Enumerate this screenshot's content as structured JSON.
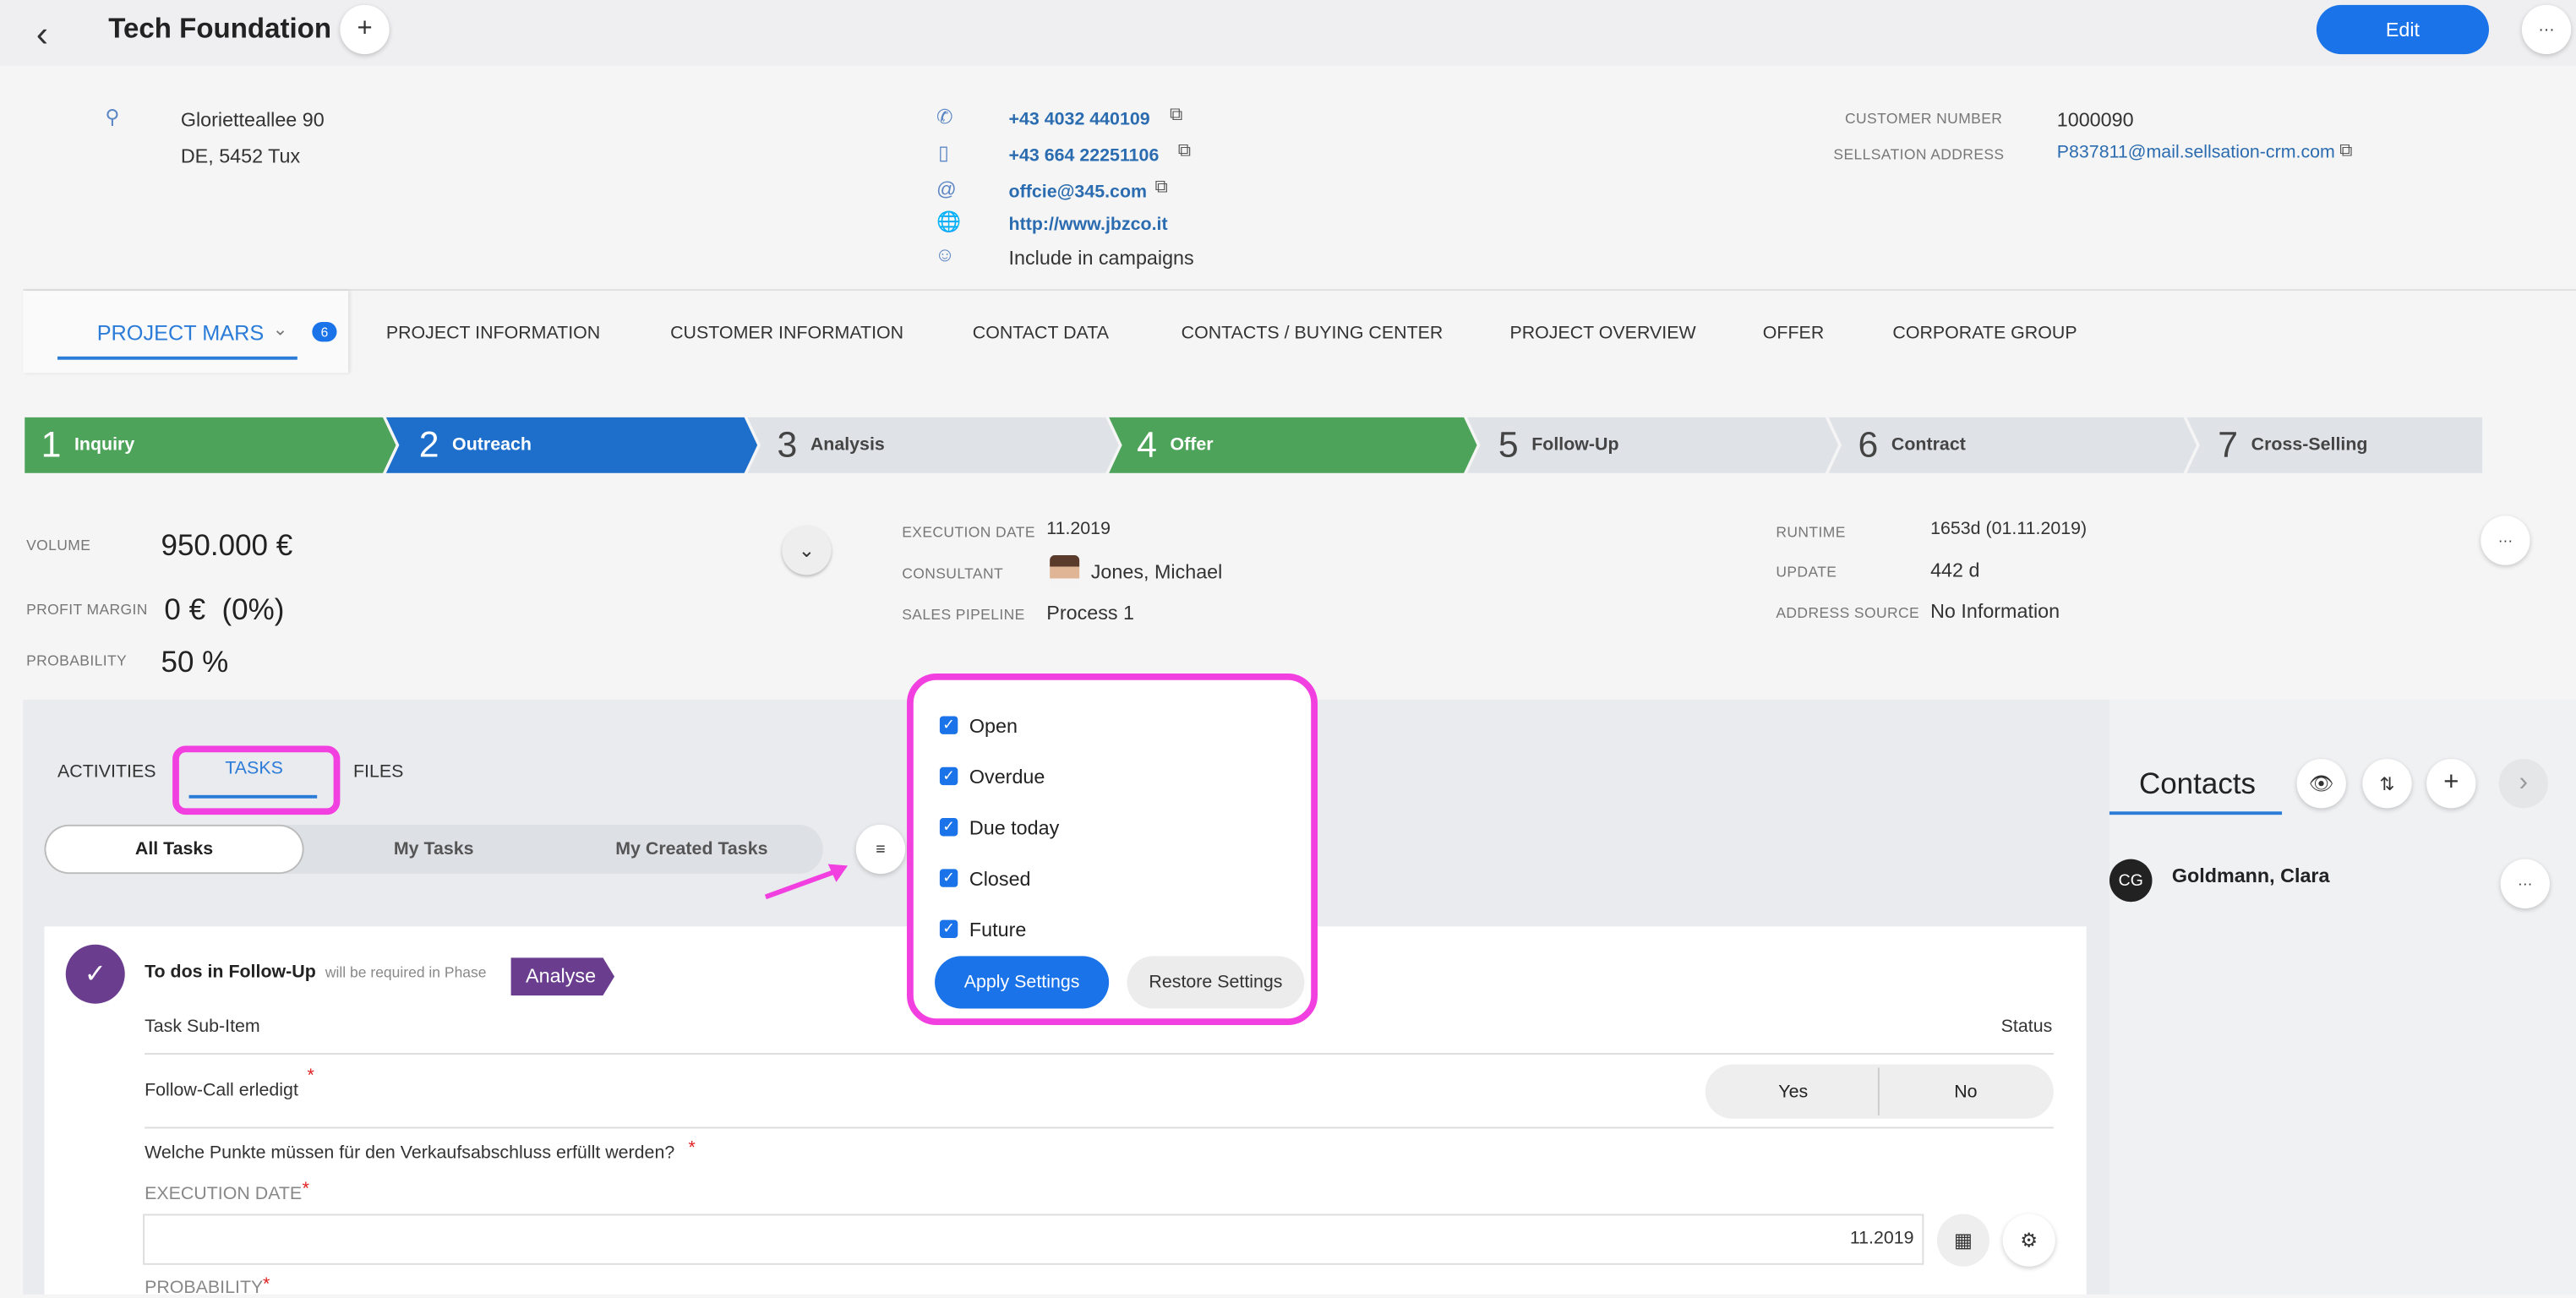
{
  "header": {
    "title": "Tech Foundation",
    "edit_label": "Edit",
    "more_label": "···",
    "add_label": "+",
    "back_label": "‹"
  },
  "address": {
    "line1": "Glorietteallee 90",
    "line2": "DE, 5452 Tux"
  },
  "contact": {
    "phone": "+43 4032 440109",
    "mobile": "+43 664 22251106",
    "email": "offcie@345.com",
    "website": "http://www.jbzco.it",
    "campaigns": "Include in campaigns"
  },
  "customer": {
    "number_label": "CUSTOMER NUMBER",
    "number": "1000090",
    "address_label": "SELLSATION ADDRESS",
    "address": "P837811@mail.sellsation-crm.com"
  },
  "tabs": {
    "project": "PROJECT MARS",
    "badge": "6",
    "items": [
      "PROJECT INFORMATION",
      "CUSTOMER INFORMATION",
      "CONTACT DATA",
      "CONTACTS / BUYING CENTER",
      "PROJECT OVERVIEW",
      "OFFER",
      "CORPORATE GROUP"
    ]
  },
  "stages": [
    {
      "num": "1",
      "label": "Inquiry",
      "color": "#4ea35a",
      "text": "#ffffff"
    },
    {
      "num": "2",
      "label": "Outreach",
      "color": "#1e6fcb",
      "text": "#ffffff"
    },
    {
      "num": "3",
      "label": "Analysis",
      "color": "#dfe3e8",
      "text": "#444444"
    },
    {
      "num": "4",
      "label": "Offer",
      "color": "#4ea35a",
      "text": "#ffffff"
    },
    {
      "num": "5",
      "label": "Follow-Up",
      "color": "#dfe3e8",
      "text": "#444444"
    },
    {
      "num": "6",
      "label": "Contract",
      "color": "#dfe3e8",
      "text": "#444444"
    },
    {
      "num": "7",
      "label": "Cross-Selling",
      "color": "#dfe3e8",
      "text": "#444444"
    }
  ],
  "kpi": {
    "volume_label": "VOLUME",
    "volume": "950.000 €",
    "margin_label": "PROFIT MARGIN",
    "margin": "0 €  (0%)",
    "prob_label": "PROBABILITY",
    "prob": "50 %",
    "exec_label": "EXECUTION DATE",
    "exec": "11.2019",
    "consultant_label": "CONSULTANT",
    "consultant": "Jones, Michael",
    "pipeline_label": "SALES PIPELINE",
    "pipeline": "Process 1",
    "runtime_label": "RUNTIME",
    "runtime": "1653d (01.11.2019)",
    "update_label": "UPDATE",
    "update": "442 d",
    "source_label": "ADDRESS SOURCE",
    "source": "No Information"
  },
  "lower": {
    "tabs": [
      "ACTIVITIES",
      "TASKS",
      "FILES"
    ],
    "filters": [
      "All Tasks",
      "My Tasks",
      "My Created Tasks"
    ],
    "todo_title": "To dos in Follow-Up",
    "todo_note": "will be required in Phase",
    "todo_phase": "Analyse",
    "col_item": "Task Sub-Item",
    "col_status": "Status",
    "row1": "Follow-Call erledigt",
    "yes": "Yes",
    "no": "No",
    "question": "Welche Punkte müssen für den Verkaufsabschluss erfüllt werden?",
    "exec_label": "EXECUTION DATE",
    "exec_value": "11.2019",
    "prob_label": "PROBABILITY"
  },
  "popup": {
    "options": [
      "Open",
      "Overdue",
      "Due today",
      "Closed",
      "Future"
    ],
    "apply": "Apply Settings",
    "restore": "Restore Settings"
  },
  "contacts": {
    "title": "Contacts",
    "initials": "CG",
    "name": "Goldmann, Clara"
  },
  "accent": "#1a73e8",
  "highlight": "#f23fe0"
}
